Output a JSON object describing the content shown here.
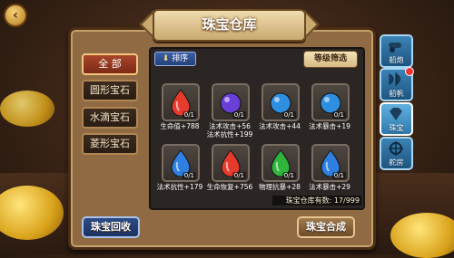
{
  "header": {
    "title": "珠宝仓库",
    "back_icon": "back-arrow-icon"
  },
  "sort": {
    "label": "排序",
    "icon": "sort-arrow-icon"
  },
  "filter": {
    "label": "等级筛选"
  },
  "categories": [
    {
      "label": "全 部",
      "active": true
    },
    {
      "label": "圆形宝石",
      "active": false
    },
    {
      "label": "水滴宝石",
      "active": false
    },
    {
      "label": "菱形宝石",
      "active": false
    }
  ],
  "gems": [
    {
      "type": "drop",
      "color": "#e43b2c",
      "level": "0/1",
      "stats": [
        "生命值+788"
      ]
    },
    {
      "type": "round",
      "color": "#6a3fd8",
      "level": "0/1",
      "stats": [
        "法术攻击+56",
        "法术抗性+199"
      ]
    },
    {
      "type": "round",
      "color": "#2e8fe0",
      "level": "0/1",
      "stats": [
        "法术攻击+44"
      ]
    },
    {
      "type": "round",
      "color": "#2e8fe0",
      "level": "0/1",
      "stats": [
        "法术暴击+19"
      ]
    },
    {
      "type": "drop",
      "color": "#2e7fe0",
      "level": "0/1",
      "stats": [
        "法术抗性+179"
      ]
    },
    {
      "type": "drop",
      "color": "#e43b2c",
      "level": "0/1",
      "stats": [
        "生命恢复+756"
      ]
    },
    {
      "type": "drop",
      "color": "#2fb53b",
      "level": "0/1",
      "stats": [
        "物理抗暴+28"
      ]
    },
    {
      "type": "drop",
      "color": "#2e7fe0",
      "level": "0/1",
      "stats": [
        "法术暴击+29"
      ]
    }
  ],
  "storage": {
    "text": "珠宝仓库有数: 17/999"
  },
  "buttons": {
    "recycle": "珠宝回收",
    "synthesize": "珠宝合成"
  },
  "right_nav": [
    {
      "label": "船炮",
      "icon": "cannon-icon",
      "active": false,
      "badge": false
    },
    {
      "label": "船帆",
      "icon": "sail-icon",
      "active": false,
      "badge": true
    },
    {
      "label": "珠宝",
      "icon": "jewel-icon",
      "active": true,
      "badge": false
    },
    {
      "label": "舵房",
      "icon": "ship-wheel-icon",
      "active": false,
      "badge": false
    }
  ]
}
